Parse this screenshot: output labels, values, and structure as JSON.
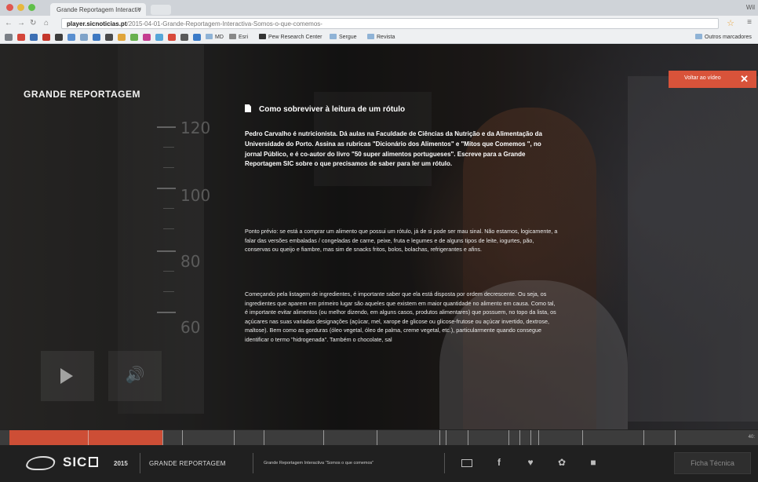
{
  "browser": {
    "tab_title": "Grande Reportagem Interactiv",
    "tab_close": "×",
    "profile_label": "Wil",
    "url_host": "player.sicnoticias.pt",
    "url_path": "/2015-04-01-Grande-Reportagem-Interactiva-Somos-o-que-comemos-",
    "bookmarks": [
      "MD",
      "Pew Research Center",
      "Sergue",
      "Revista"
    ],
    "other_bookmarks": "Outros marcadores"
  },
  "page": {
    "brand": "GRANDE REPORTAGEM",
    "close_video_label": "Voltar ao vídeo",
    "close_icon": "✕",
    "ruler_numbers": [
      "120",
      "100",
      "80",
      "60"
    ],
    "article": {
      "title": "Como sobreviver à leitura de um rótulo",
      "intro": "Pedro Carvalho é nutricionista. Dá aulas na Faculdade de Ciências da Nutrição e da Alimentação da Universidade do Porto. Assina as rubricas \"Dicionário dos Alimentos\" e \"Mitos que Comemos \", no jornal Público, e é co-autor do livro \"50 super alimentos portugueses\". Escreve para a Grande Reportagem SIC sobre o que precisamos de saber para ler um rótulo.",
      "paragraphs": [
        "Ponto prévio: se está a comprar um alimento que possui um rótulo, já de si pode ser mau sinal. Não estamos, logicamente, a falar das versões embaladas / congeladas de carne, peixe, fruta e legumes e de alguns tipos de leite, iogurtes, pão, conservas ou queijo e fiambre, mas sim de snacks fritos, bolos, bolachas, refrigerantes e afins.",
        "Começando pela listagem de ingredientes, é importante saber que ela está disposta por ordem decrescente. Ou seja, os ingredientes que aparem em primeiro lugar são aqueles que existem em maior quantidade no alimento em causa. Como tal, é importante evitar alimentos (ou melhor dizendo, em alguns casos, produtos alimentares) que possuem, no topo da lista, os açúcares nas suas variadas designações (açúcar, mel, xarope de glicose ou glicose-frutose ou açúcar invertido, dextrose, maltose). Bem como as gorduras (óleo vegetal, óleo de palma, creme vegetal, etc.), particularmente quando consegue identificar o termo \"hidrogenada\". Também o chocolate, sal"
      ]
    },
    "timeline_end": "40:"
  },
  "footer": {
    "sic_logo": "SIC",
    "year": "2015",
    "brand": "GRANDE REPORTAGEM",
    "subtitle": "Grande Reportagem Interactiva \"Somos o que comemos\"",
    "share_facebook": "f",
    "share_twitter": "♥",
    "share_pinterest": "✿",
    "share_other": "■",
    "ficha_tecnica": "Ficha Técnica"
  },
  "colors": {
    "accent": "#cd4e36",
    "close_button": "#d8533a",
    "footer_bg": "#202020"
  }
}
